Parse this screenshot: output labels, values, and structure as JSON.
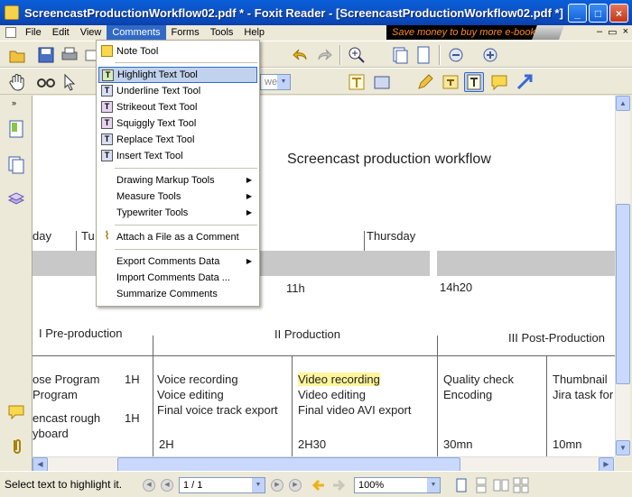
{
  "window": {
    "title": "ScreencastProductionWorkflow02.pdf * - Foxit Reader - [ScreencastProductionWorkflow02.pdf *]",
    "ad_text": "Save money to buy more e-books"
  },
  "menubar": {
    "items": [
      "File",
      "Edit",
      "View",
      "Comments",
      "Forms",
      "Tools",
      "Help"
    ],
    "active": "Comments"
  },
  "toolbar": {
    "zoom_field_placeholder": "wel"
  },
  "comments_menu": {
    "items": [
      {
        "label": "Note Tool",
        "icon": "note-icon"
      },
      {
        "label": "Highlight Text Tool",
        "icon": "highlight-icon",
        "hovered": true
      },
      {
        "label": "Underline Text Tool",
        "icon": "underline-icon"
      },
      {
        "label": "Strikeout Text Tool",
        "icon": "strikeout-icon"
      },
      {
        "label": "Squiggly Text Tool",
        "icon": "squiggly-icon"
      },
      {
        "label": "Replace Text Tool",
        "icon": "replace-icon"
      },
      {
        "label": "Insert Text Tool",
        "icon": "insert-icon"
      },
      {
        "label": "Drawing Markup Tools",
        "submenu": true
      },
      {
        "label": "Measure Tools",
        "submenu": true
      },
      {
        "label": "Typewriter Tools",
        "submenu": true
      },
      {
        "label": "Attach a File as a Comment",
        "icon": "paperclip-icon"
      },
      {
        "label": "Export Comments Data",
        "submenu": true
      },
      {
        "label": "Import Comments Data ...",
        "submenu": false
      },
      {
        "label": "Summarize Comments",
        "submenu": false
      }
    ]
  },
  "document": {
    "title": "Screencast production workflow",
    "days": [
      "day",
      "Tu",
      "Thursday"
    ],
    "times": [
      "11h",
      "14h20"
    ],
    "phases": [
      "I Pre-production",
      "II Production",
      "III Post-Production"
    ],
    "col1": [
      "ose Program",
      "Program",
      "encast rough",
      "yboard",
      "1H",
      "1H"
    ],
    "col2": [
      "Voice recording",
      "Voice editing",
      "Final voice track export",
      "2H"
    ],
    "col3": [
      "Video recording",
      "Video editing",
      "Final video AVI export",
      "2H30"
    ],
    "col4": [
      "Quality check",
      "Encoding",
      "30mn"
    ],
    "col5": [
      "Thumbnail",
      "Jira task for",
      "10mn"
    ]
  },
  "statusbar": {
    "message": "Select text to highlight it.",
    "page": "1 / 1",
    "zoom": "100%"
  },
  "colors": {
    "titlebar": "#0a5fd8",
    "menu_active": "#316ac5",
    "highlight": "#fff59b",
    "ad_text": "#ff8a1a"
  }
}
